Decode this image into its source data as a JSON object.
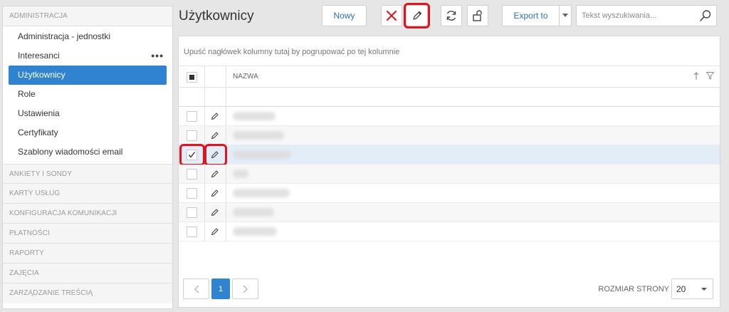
{
  "sidebar": {
    "top_section": "ADMINISTRACJA",
    "items": [
      {
        "label": "Administracja - jednostki"
      },
      {
        "label": "Interesanci",
        "more": "•••"
      },
      {
        "label": "Użytkownicy"
      },
      {
        "label": "Role"
      },
      {
        "label": "Ustawienia"
      },
      {
        "label": "Certyfikaty"
      },
      {
        "label": "Szablony wiadomości email"
      }
    ],
    "sections": [
      "ANKIETY I SONDY",
      "KARTY USŁUG",
      "KONFIGURACJA KOMUNIKACJI",
      "PŁATNOŚCI",
      "RAPORTY",
      "ZAJĘCIA",
      "ZARZĄDZANIE TREŚCIĄ"
    ]
  },
  "header": {
    "title": "Użytkownicy",
    "new_label": "Nowy",
    "export_label": "Export to",
    "search_placeholder": "Tekst wyszukiwania..."
  },
  "grid": {
    "group_hint": "Upuść nagłówek kolumny tutaj by pogrupować po tej kolumnie",
    "column_name": "NAZWA",
    "rows": [
      {
        "checked": false,
        "selected": false,
        "alt": false
      },
      {
        "checked": false,
        "selected": false,
        "alt": true
      },
      {
        "checked": true,
        "selected": true,
        "alt": false
      },
      {
        "checked": false,
        "selected": false,
        "alt": true
      },
      {
        "checked": false,
        "selected": false,
        "alt": false
      },
      {
        "checked": false,
        "selected": false,
        "alt": true
      },
      {
        "checked": false,
        "selected": false,
        "alt": false
      }
    ]
  },
  "pager": {
    "current_page": "1",
    "page_size_label": "ROZMIAR STRONY",
    "page_size": "20"
  },
  "colors": {
    "accent": "#2f83d1",
    "highlight": "#e0141e",
    "delete": "#d0202a"
  }
}
